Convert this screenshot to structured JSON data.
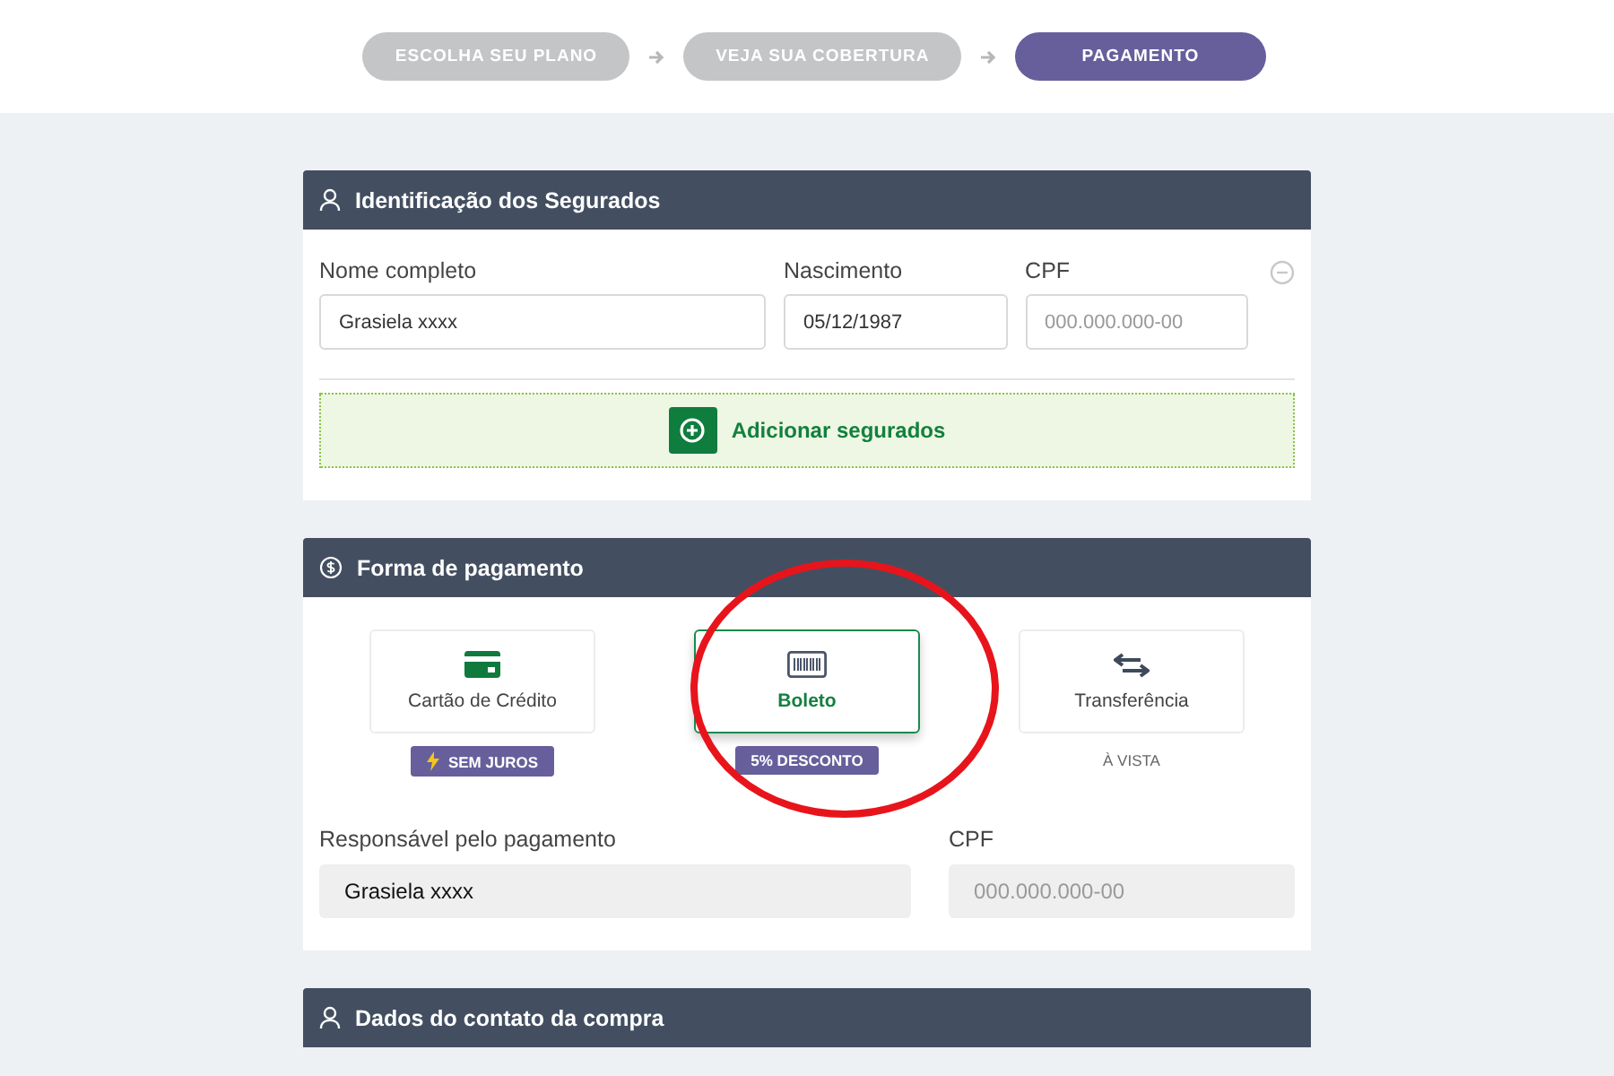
{
  "steps": [
    {
      "label": "ESCOLHA SEU PLANO",
      "selected": false
    },
    {
      "label": "VEJA SUA COBERTURA",
      "selected": false
    },
    {
      "label": "PAGAMENTO",
      "selected": true
    }
  ],
  "insured": {
    "title": "Identificação dos Segurados",
    "fields": [
      {
        "label": "Nome completo",
        "value": "Grasiela xxxx"
      },
      {
        "label": "Nascimento",
        "value": "05/12/1987"
      },
      {
        "label": "CPF",
        "placeholder": "000.000.000-00"
      }
    ],
    "add_button": "Adicionar segurados"
  },
  "payment": {
    "title": "Forma de pagamento",
    "options": [
      {
        "kind": "card",
        "label": "Cartão de Crédito",
        "selected": false,
        "note": {
          "text": "SEM JUROS",
          "kind": "tag",
          "bolt": true
        }
      },
      {
        "kind": "barcode",
        "label": "Boleto",
        "selected": true,
        "note": {
          "text": "5% DESCONTO",
          "kind": "tag",
          "bolt": false
        }
      },
      {
        "kind": "transfer",
        "label": "Transferência",
        "selected": false,
        "note": {
          "text": "À VISTA",
          "kind": "plain",
          "bolt": false
        }
      }
    ],
    "fields": [
      {
        "label": "Responsável pelo pagamento",
        "value": "Grasiela xxxx"
      },
      {
        "label": "CPF",
        "placeholder": "000.000.000-00"
      }
    ]
  },
  "contact": {
    "title": "Dados do contato da compra"
  },
  "annotations": [
    {
      "kind": "ellipse"
    }
  ]
}
